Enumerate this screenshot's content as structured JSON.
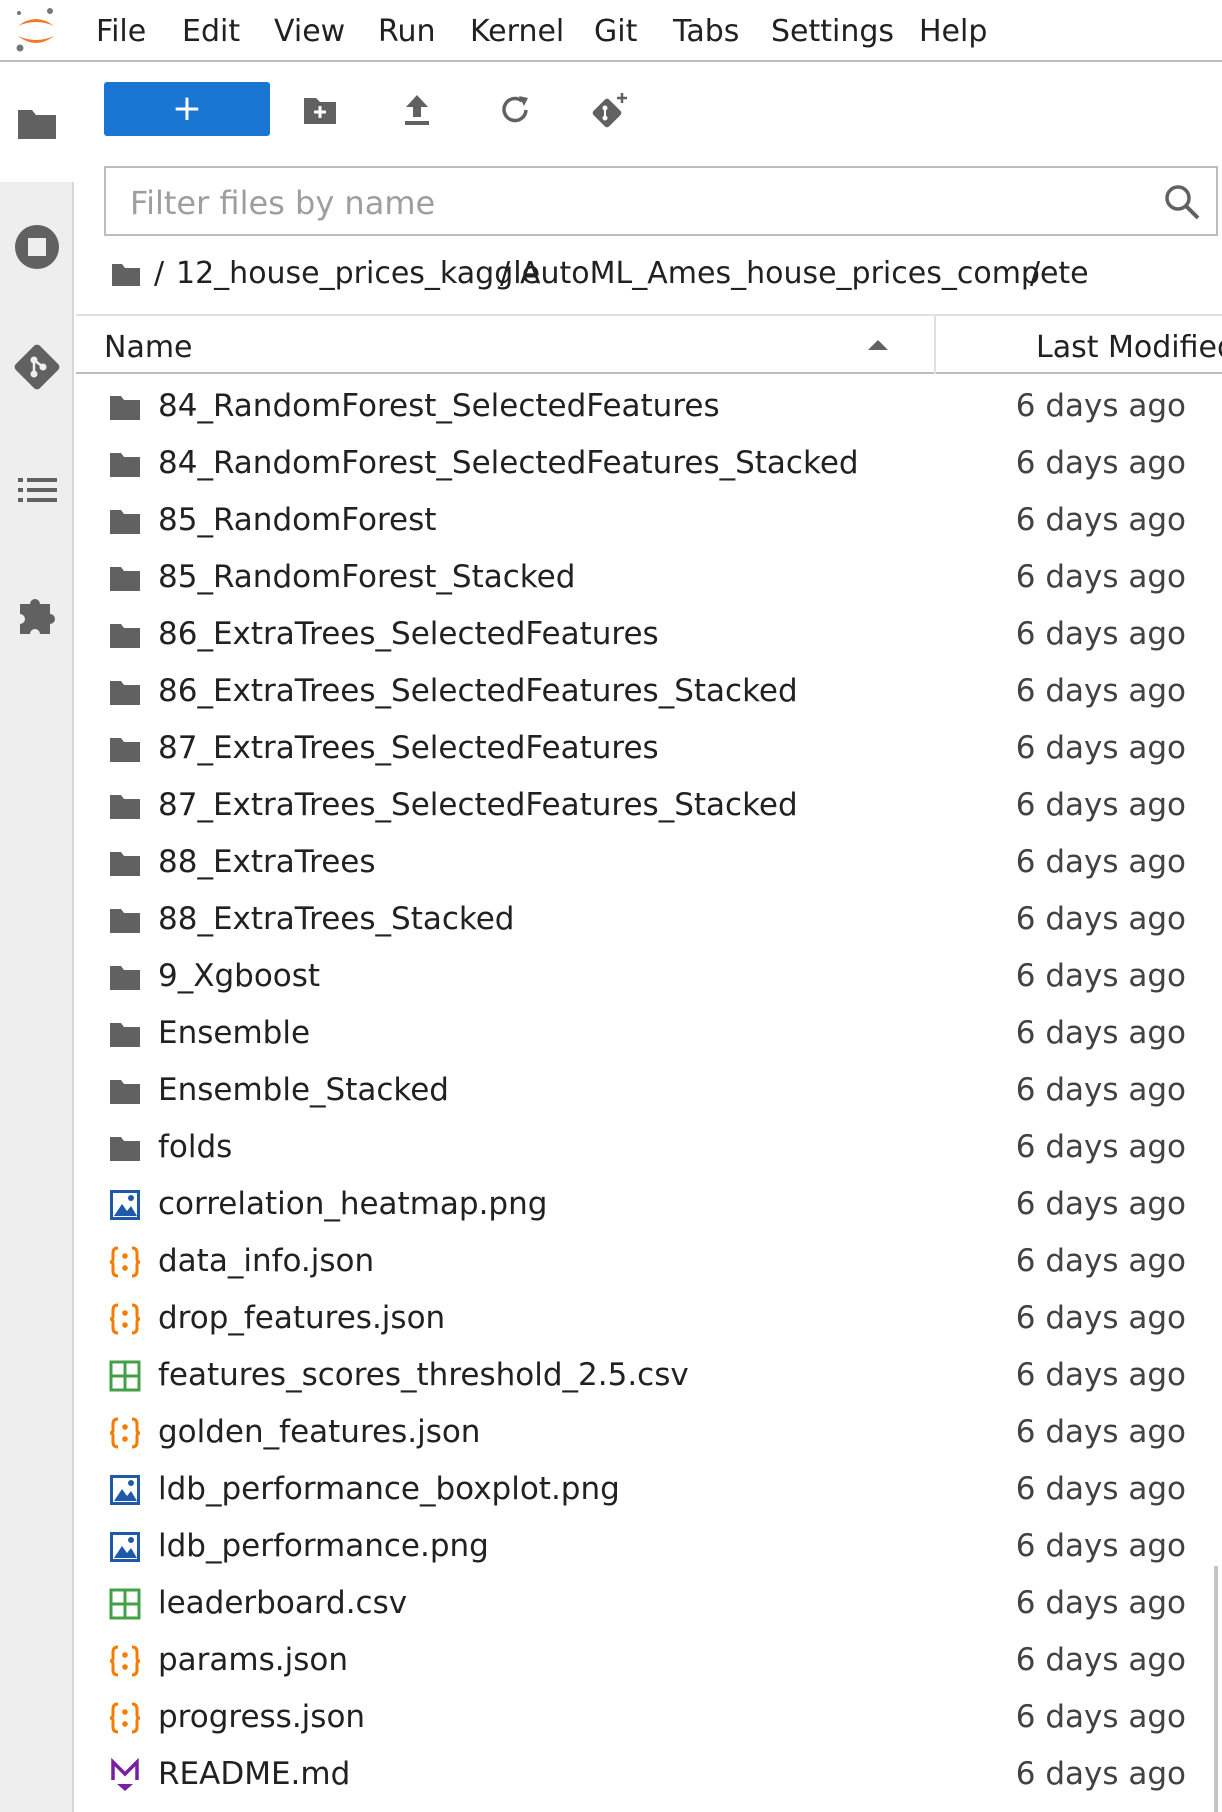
{
  "app": {
    "logo": "jupyter-logo"
  },
  "menu": [
    "File",
    "Edit",
    "View",
    "Run",
    "Kernel",
    "Git",
    "Tabs",
    "Settings",
    "Help"
  ],
  "sidebar_icons": [
    "folder-icon",
    "running-icon",
    "git-icon",
    "toc-icon",
    "extension-icon"
  ],
  "toolbar": {
    "new_label": "+",
    "icons": [
      "new-folder-icon",
      "upload-icon",
      "refresh-icon",
      "git-clone-icon"
    ]
  },
  "filter": {
    "placeholder": "Filter files by name",
    "value": ""
  },
  "breadcrumb": [
    "/",
    "12_house_prices_kaggle",
    "/",
    "AutoML_Ames_house_prices_compete",
    "/"
  ],
  "columns": {
    "name": "Name",
    "modified": "Last Modified",
    "sort": "ascending"
  },
  "files": [
    {
      "name": "84_RandomForest_SelectedFeatures",
      "type": "folder",
      "modified": "6 days ago"
    },
    {
      "name": "84_RandomForest_SelectedFeatures_Stacked",
      "type": "folder",
      "modified": "6 days ago"
    },
    {
      "name": "85_RandomForest",
      "type": "folder",
      "modified": "6 days ago"
    },
    {
      "name": "85_RandomForest_Stacked",
      "type": "folder",
      "modified": "6 days ago"
    },
    {
      "name": "86_ExtraTrees_SelectedFeatures",
      "type": "folder",
      "modified": "6 days ago"
    },
    {
      "name": "86_ExtraTrees_SelectedFeatures_Stacked",
      "type": "folder",
      "modified": "6 days ago"
    },
    {
      "name": "87_ExtraTrees_SelectedFeatures",
      "type": "folder",
      "modified": "6 days ago"
    },
    {
      "name": "87_ExtraTrees_SelectedFeatures_Stacked",
      "type": "folder",
      "modified": "6 days ago"
    },
    {
      "name": "88_ExtraTrees",
      "type": "folder",
      "modified": "6 days ago"
    },
    {
      "name": "88_ExtraTrees_Stacked",
      "type": "folder",
      "modified": "6 days ago"
    },
    {
      "name": "9_Xgboost",
      "type": "folder",
      "modified": "6 days ago"
    },
    {
      "name": "Ensemble",
      "type": "folder",
      "modified": "6 days ago"
    },
    {
      "name": "Ensemble_Stacked",
      "type": "folder",
      "modified": "6 days ago"
    },
    {
      "name": "folds",
      "type": "folder",
      "modified": "6 days ago"
    },
    {
      "name": "correlation_heatmap.png",
      "type": "image",
      "modified": "6 days ago"
    },
    {
      "name": "data_info.json",
      "type": "json",
      "modified": "6 days ago"
    },
    {
      "name": "drop_features.json",
      "type": "json",
      "modified": "6 days ago"
    },
    {
      "name": "features_scores_threshold_2.5.csv",
      "type": "csv",
      "modified": "6 days ago"
    },
    {
      "name": "golden_features.json",
      "type": "json",
      "modified": "6 days ago"
    },
    {
      "name": "ldb_performance_boxplot.png",
      "type": "image",
      "modified": "6 days ago"
    },
    {
      "name": "ldb_performance.png",
      "type": "image",
      "modified": "6 days ago"
    },
    {
      "name": "leaderboard.csv",
      "type": "csv",
      "modified": "6 days ago"
    },
    {
      "name": "params.json",
      "type": "json",
      "modified": "6 days ago"
    },
    {
      "name": "progress.json",
      "type": "json",
      "modified": "6 days ago"
    },
    {
      "name": "README.md",
      "type": "markdown",
      "modified": "6 days ago"
    }
  ],
  "colors": {
    "accent": "#1976d2",
    "folder": "#616161",
    "json": "#f57c00",
    "image": "#1e5aa8",
    "csv": "#43a047",
    "markdown": "#7b1fa2"
  }
}
